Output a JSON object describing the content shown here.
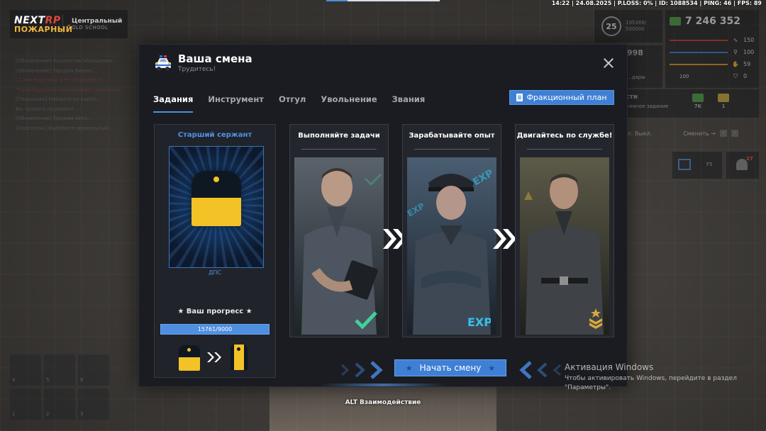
{
  "status_line": "14:22 | 24.08.2025 | P.LOSS: 0% | ID: 1088534 | PING: 46 | FPS: 89",
  "logo": {
    "line1_a": "NEXT",
    "line1_b": "RP",
    "line2": "ПОЖАРНЫЙ"
  },
  "server": {
    "name": "Центральный",
    "sub": "OLD SCHOOL"
  },
  "chat": [
    "[Объявление] Коллектив обращения...",
    "[Объявление] Продам бизнес...",
    "[ Саня Картонки ] *** Подошёл к...",
    "*Саня Картонки осматривает пациента...",
    "[Подсказка] Найдите на карте...",
    "Вы тратите на ремонт...",
    "[Объявление] Продам авто...",
    "[Подсказка] Выберите правильный..."
  ],
  "hud": {
    "level": "25",
    "xp_line1": "195369/",
    "xp_line2": "500000",
    "money": "7 246 352",
    "stats": [
      {
        "icon": "heartbeat-icon",
        "glyph": "∿",
        "value": "150",
        "color": "#c0392b"
      },
      {
        "icon": "food-icon",
        "glyph": "⚲",
        "value": "100",
        "color": "#2f7fd6"
      },
      {
        "icon": "hand-icon",
        "glyph": "✋",
        "value": "59",
        "color": "#e08a1e"
      },
      {
        "icon": "shield-icon",
        "glyph": "⛉",
        "value": "0",
        "color": "#888888"
      }
    ],
    "small_stat": "100",
    "mid_value": "998",
    "mid_sub": "...дары",
    "tasks_title": "...сти",
    "tasks_sub": "...дневное задание",
    "reward_money": "7K",
    "reward_gold": "1",
    "radio_label": "...ал: Выкл.",
    "radio_switch": "Сменить →",
    "cal_key": "F5",
    "bell_count": "27"
  },
  "hotbar": [
    "1",
    "2",
    "3",
    "4",
    "5",
    "6"
  ],
  "modal": {
    "title": "Ваша смена",
    "subtitle": "Трудитесь!",
    "tabs": [
      "Задания",
      "Инструмент",
      "Отгул",
      "Увольнение",
      "Звания"
    ],
    "active_tab": 0,
    "plan_button": "Фракционный план",
    "rank": {
      "title": "Старший сержант",
      "department": "ДПС",
      "progress_label": "★ Ваш прогресс ★",
      "progress_text": "15761/9000",
      "progress_fraction": 1.0
    },
    "steps": [
      {
        "title": "Выполняйте задачи",
        "badge": "check"
      },
      {
        "title": "Зарабатывайте опыт",
        "badge": "EXP"
      },
      {
        "title": "Двигайтесь по службе!",
        "badge": "rank"
      }
    ],
    "start_button": "Начать смену"
  },
  "alt_hint": "ALT Взаимодействие",
  "windows_activation": {
    "title": "Активация Windows",
    "text": "Чтобы активировать Windows, перейдите в раздел \"Параметры\"."
  },
  "colors": {
    "accent": "#3f80d4",
    "rank_gold": "#f3c226",
    "panel": "#1a1c21"
  }
}
